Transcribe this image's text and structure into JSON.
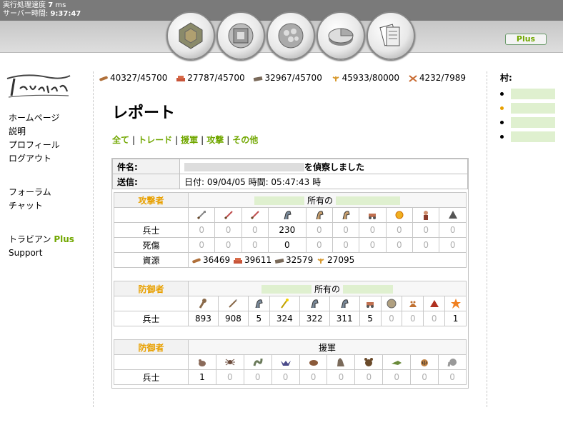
{
  "topbar": {
    "exec_label": "実行処理速度",
    "exec_value": "7",
    "exec_unit": "ms",
    "server_label": "サーバー時間:",
    "server_time": "9:37:47"
  },
  "plus_button": "Plus",
  "nav_icons": [
    "village-overview-icon",
    "village-center-icon",
    "map-icon",
    "statistics-icon",
    "reports-icon"
  ],
  "menu": {
    "items": [
      "ホームページ",
      "説明",
      "プロフィール",
      "ログアウト"
    ],
    "items2": [
      "フォーラム",
      "チャット"
    ],
    "travian_label": "トラビアン",
    "plus_label": "Plus",
    "support": "Support"
  },
  "resources": [
    {
      "icon": "wood-icon",
      "value": "40327/45700"
    },
    {
      "icon": "clay-icon",
      "value": "27787/45700"
    },
    {
      "icon": "iron-icon",
      "value": "32967/45700"
    },
    {
      "icon": "crop-icon",
      "value": "45933/80000"
    },
    {
      "icon": "crop-consumption-icon",
      "value": "4232/7989"
    }
  ],
  "villages": {
    "title": "村:"
  },
  "page": {
    "title": "レポート",
    "filters": [
      "全て",
      "トレード",
      "援軍",
      "攻撃",
      "その他"
    ]
  },
  "report": {
    "subject_label": "件名:",
    "subject_suffix": "を偵察しました",
    "sent_label": "送信:",
    "sent_value": "日付: 09/04/05 時間: 05:47:43 時"
  },
  "attacker": {
    "label": "攻撃者",
    "owner_text": "所有の",
    "row_troops_label": "兵士",
    "row_casualties_label": "死傷",
    "row_resources_label": "資源",
    "troops": [
      "0",
      "0",
      "0",
      "230",
      "0",
      "0",
      "0",
      "0",
      "0",
      "0"
    ],
    "casualties": [
      "0",
      "0",
      "0",
      "0",
      "0",
      "0",
      "0",
      "0",
      "0",
      "0"
    ],
    "loot": [
      "36469",
      "39611",
      "32579",
      "27095"
    ]
  },
  "defender": {
    "label": "防御者",
    "owner_text": "所有の",
    "row_troops_label": "兵士",
    "troops": [
      "893",
      "908",
      "5",
      "324",
      "322",
      "311",
      "5",
      "0",
      "0",
      "0",
      "1"
    ]
  },
  "reinforcement": {
    "label": "防御者",
    "owner_text": "援軍",
    "row_troops_label": "兵士",
    "troops": [
      "1",
      "0",
      "0",
      "0",
      "0",
      "0",
      "0",
      "0",
      "0",
      "0"
    ]
  },
  "colors": {
    "accent_green": "#71a700",
    "accent_orange": "#e8a000",
    "topbar": "#7a7a7a"
  }
}
